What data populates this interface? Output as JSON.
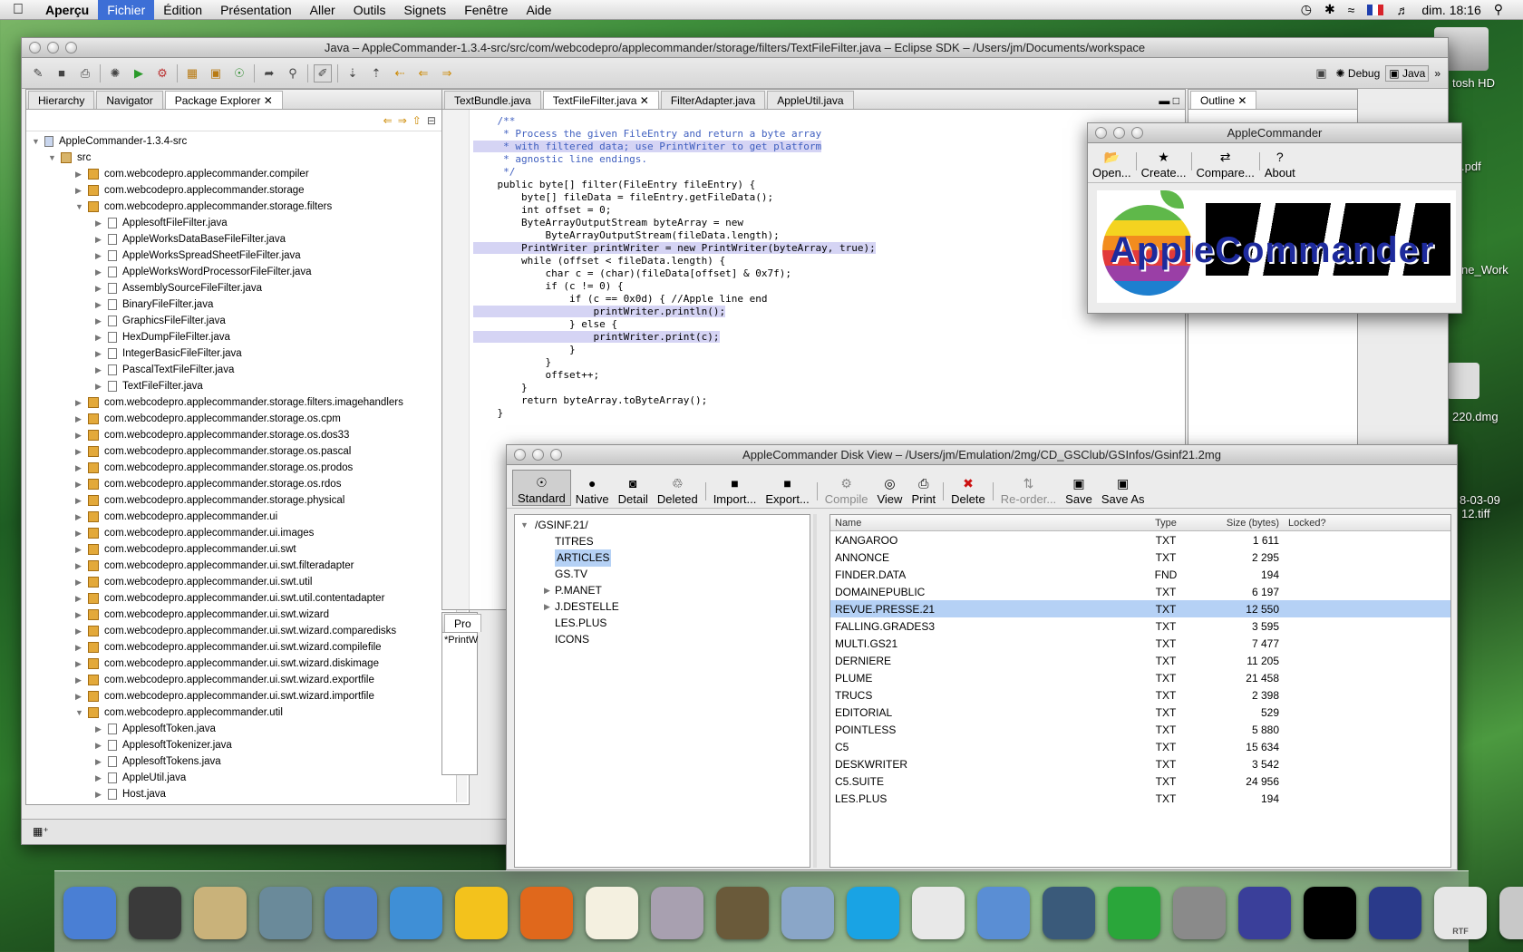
{
  "menubar": {
    "app": "Aperçu",
    "items": [
      "Fichier",
      "Édition",
      "Présentation",
      "Aller",
      "Outils",
      "Signets",
      "Fenêtre",
      "Aide"
    ],
    "clock": "dim. 18:16"
  },
  "desktop": {
    "items": [
      "tosh HD",
      ".pdf",
      "ne_Work",
      "220.dmg",
      "8-03-09",
      "12.tiff"
    ]
  },
  "eclipse": {
    "title": "Java – AppleCommander-1.3.4-src/src/com/webcodepro/applecommander/storage/filters/TextFileFilter.java – Eclipse SDK – /Users/jm/Documents/workspace",
    "perspectives": {
      "debug": "Debug",
      "java": "Java"
    },
    "left_tabs": [
      "Hierarchy",
      "Navigator",
      "Package Explorer"
    ],
    "project": "AppleCommander-1.3.4-src",
    "src": "src",
    "tree": [
      {
        "label": "com.webcodepro.applecommander.compiler",
        "t": "pkg",
        "lvl": 2,
        "ex": false
      },
      {
        "label": "com.webcodepro.applecommander.storage",
        "t": "pkg",
        "lvl": 2,
        "ex": false
      },
      {
        "label": "com.webcodepro.applecommander.storage.filters",
        "t": "pkg",
        "lvl": 2,
        "ex": true
      },
      {
        "label": "ApplesoftFileFilter.java",
        "t": "j",
        "lvl": 3
      },
      {
        "label": "AppleWorksDataBaseFileFilter.java",
        "t": "j",
        "lvl": 3
      },
      {
        "label": "AppleWorksSpreadSheetFileFilter.java",
        "t": "j",
        "lvl": 3
      },
      {
        "label": "AppleWorksWordProcessorFileFilter.java",
        "t": "j",
        "lvl": 3
      },
      {
        "label": "AssemblySourceFileFilter.java",
        "t": "j",
        "lvl": 3
      },
      {
        "label": "BinaryFileFilter.java",
        "t": "j",
        "lvl": 3
      },
      {
        "label": "GraphicsFileFilter.java",
        "t": "j",
        "lvl": 3
      },
      {
        "label": "HexDumpFileFilter.java",
        "t": "j",
        "lvl": 3
      },
      {
        "label": "IntegerBasicFileFilter.java",
        "t": "j",
        "lvl": 3
      },
      {
        "label": "PascalTextFileFilter.java",
        "t": "j",
        "lvl": 3
      },
      {
        "label": "TextFileFilter.java",
        "t": "j",
        "lvl": 3
      },
      {
        "label": "com.webcodepro.applecommander.storage.filters.imagehandlers",
        "t": "pkg",
        "lvl": 2,
        "ex": false
      },
      {
        "label": "com.webcodepro.applecommander.storage.os.cpm",
        "t": "pkg",
        "lvl": 2,
        "ex": false
      },
      {
        "label": "com.webcodepro.applecommander.storage.os.dos33",
        "t": "pkg",
        "lvl": 2,
        "ex": false
      },
      {
        "label": "com.webcodepro.applecommander.storage.os.pascal",
        "t": "pkg",
        "lvl": 2,
        "ex": false
      },
      {
        "label": "com.webcodepro.applecommander.storage.os.prodos",
        "t": "pkg",
        "lvl": 2,
        "ex": false
      },
      {
        "label": "com.webcodepro.applecommander.storage.os.rdos",
        "t": "pkg",
        "lvl": 2,
        "ex": false
      },
      {
        "label": "com.webcodepro.applecommander.storage.physical",
        "t": "pkg",
        "lvl": 2,
        "ex": false
      },
      {
        "label": "com.webcodepro.applecommander.ui",
        "t": "pkg",
        "lvl": 2,
        "ex": false
      },
      {
        "label": "com.webcodepro.applecommander.ui.images",
        "t": "pkg",
        "lvl": 2,
        "ex": false
      },
      {
        "label": "com.webcodepro.applecommander.ui.swt",
        "t": "pkg",
        "lvl": 2,
        "ex": false
      },
      {
        "label": "com.webcodepro.applecommander.ui.swt.filteradapter",
        "t": "pkg",
        "lvl": 2,
        "ex": false
      },
      {
        "label": "com.webcodepro.applecommander.ui.swt.util",
        "t": "pkg",
        "lvl": 2,
        "ex": false
      },
      {
        "label": "com.webcodepro.applecommander.ui.swt.util.contentadapter",
        "t": "pkg",
        "lvl": 2,
        "ex": false
      },
      {
        "label": "com.webcodepro.applecommander.ui.swt.wizard",
        "t": "pkg",
        "lvl": 2,
        "ex": false
      },
      {
        "label": "com.webcodepro.applecommander.ui.swt.wizard.comparedisks",
        "t": "pkg",
        "lvl": 2,
        "ex": false
      },
      {
        "label": "com.webcodepro.applecommander.ui.swt.wizard.compilefile",
        "t": "pkg",
        "lvl": 2,
        "ex": false
      },
      {
        "label": "com.webcodepro.applecommander.ui.swt.wizard.diskimage",
        "t": "pkg",
        "lvl": 2,
        "ex": false
      },
      {
        "label": "com.webcodepro.applecommander.ui.swt.wizard.exportfile",
        "t": "pkg",
        "lvl": 2,
        "ex": false
      },
      {
        "label": "com.webcodepro.applecommander.ui.swt.wizard.importfile",
        "t": "pkg",
        "lvl": 2,
        "ex": false
      },
      {
        "label": "com.webcodepro.applecommander.util",
        "t": "pkg",
        "lvl": 2,
        "ex": true
      },
      {
        "label": "ApplesoftToken.java",
        "t": "j",
        "lvl": 3
      },
      {
        "label": "ApplesoftTokenizer.java",
        "t": "j",
        "lvl": 3
      },
      {
        "label": "ApplesoftTokens.java",
        "t": "j",
        "lvl": 3
      },
      {
        "label": "AppleUtil.java",
        "t": "j",
        "lvl": 3
      },
      {
        "label": "Host.java",
        "t": "j",
        "lvl": 3
      }
    ],
    "editor_tabs": [
      "TextBundle.java",
      "TextFileFilter.java",
      "FilterAdapter.java",
      "AppleUtil.java"
    ],
    "outline_tab": "Outline",
    "bottom_tab": "Pro",
    "bottom_line": "*PrintW",
    "code": [
      {
        "text": "    /**",
        "cls": "cm",
        "hl": false
      },
      {
        "text": "     * Process the given FileEntry and return a byte array",
        "cls": "cm",
        "hl": false
      },
      {
        "text": "     * with filtered data; use PrintWriter to get platform",
        "cls": "cm",
        "hl": true
      },
      {
        "text": "     * agnostic line endings.",
        "cls": "cm",
        "hl": false
      },
      {
        "text": "     */",
        "cls": "cm",
        "hl": false
      },
      {
        "text": "    public byte[] filter(FileEntry fileEntry) {",
        "cls": "",
        "hl": false
      },
      {
        "text": "        byte[] fileData = fileEntry.getFileData();",
        "cls": "",
        "hl": false
      },
      {
        "text": "        int offset = 0;",
        "cls": "",
        "hl": false
      },
      {
        "text": "        ByteArrayOutputStream byteArray = new",
        "cls": "",
        "hl": false
      },
      {
        "text": "            ByteArrayOutputStream(fileData.length);",
        "cls": "",
        "hl": false
      },
      {
        "text": "        PrintWriter printWriter = new PrintWriter(byteArray, true);",
        "cls": "",
        "hl": true
      },
      {
        "text": "        while (offset < fileData.length) {",
        "cls": "",
        "hl": false
      },
      {
        "text": "            char c = (char)(fileData[offset] & 0x7f);",
        "cls": "",
        "hl": false
      },
      {
        "text": "            if (c != 0) {",
        "cls": "",
        "hl": false
      },
      {
        "text": "                if (c == 0x0d) { //Apple line end",
        "cls": "",
        "hl": false
      },
      {
        "text": "                    printWriter.println();",
        "cls": "",
        "hl": true
      },
      {
        "text": "                } else {",
        "cls": "",
        "hl": false
      },
      {
        "text": "                    printWriter.print(c);",
        "cls": "",
        "hl": true
      },
      {
        "text": "                }",
        "cls": "",
        "hl": false
      },
      {
        "text": "            }",
        "cls": "",
        "hl": false
      },
      {
        "text": "            offset++;",
        "cls": "",
        "hl": false
      },
      {
        "text": "        }",
        "cls": "",
        "hl": false
      },
      {
        "text": "        return byteArray.toByteArray();",
        "cls": "",
        "hl": false
      },
      {
        "text": "    }",
        "cls": "",
        "hl": false
      }
    ]
  },
  "ac_main": {
    "title": "AppleCommander",
    "buttons": [
      "Open...",
      "Create...",
      "Compare...",
      "About"
    ],
    "logo": "AppleCommander"
  },
  "diskview": {
    "title": "AppleCommander Disk View – /Users/jm/Emulation/2mg/CD_GSClub/GSInfos/Gsinf21.2mg",
    "toolbar": [
      {
        "label": "Standard",
        "state": "active"
      },
      {
        "label": "Native",
        "state": ""
      },
      {
        "label": "Detail",
        "state": ""
      },
      {
        "label": "Deleted",
        "state": "sep"
      },
      {
        "label": "Import...",
        "state": ""
      },
      {
        "label": "Export...",
        "state": "sep"
      },
      {
        "label": "Compile",
        "state": "dis"
      },
      {
        "label": "View",
        "state": ""
      },
      {
        "label": "Print",
        "state": "sep"
      },
      {
        "label": "Delete",
        "state": "sep"
      },
      {
        "label": "Re-order...",
        "state": "dis"
      },
      {
        "label": "Save",
        "state": ""
      },
      {
        "label": "Save As",
        "state": ""
      }
    ],
    "tree_root": "/GSINF.21/",
    "tree": [
      {
        "label": "TITRES",
        "ex": false,
        "sel": false
      },
      {
        "label": "ARTICLES",
        "ex": false,
        "sel": true
      },
      {
        "label": "GS.TV",
        "ex": false,
        "sel": false
      },
      {
        "label": "P.MANET",
        "ex": true,
        "sel": false
      },
      {
        "label": "J.DESTELLE",
        "ex": true,
        "sel": false
      },
      {
        "label": "LES.PLUS",
        "ex": false,
        "sel": false
      },
      {
        "label": "ICONS",
        "ex": false,
        "sel": false
      }
    ],
    "columns": [
      "Name",
      "Type",
      "Size (bytes)",
      "Locked?"
    ],
    "rows": [
      [
        "KANGAROO",
        "TXT",
        "1 611"
      ],
      [
        "ANNONCE",
        "TXT",
        "2 295"
      ],
      [
        "FINDER.DATA",
        "FND",
        "194"
      ],
      [
        "DOMAINEPUBLIC",
        "TXT",
        "6 197"
      ],
      [
        "REVUE.PRESSE.21",
        "TXT",
        "12 550"
      ],
      [
        "FALLING.GRADES3",
        "TXT",
        "3 595"
      ],
      [
        "MULTI.GS21",
        "TXT",
        "7 477"
      ],
      [
        "DERNIERE",
        "TXT",
        "11 205"
      ],
      [
        "PLUME",
        "TXT",
        "21 458"
      ],
      [
        "TRUCS",
        "TXT",
        "2 398"
      ],
      [
        "EDITORIAL",
        "TXT",
        "529"
      ],
      [
        "POINTLESS",
        "TXT",
        "5 880"
      ],
      [
        "C5",
        "TXT",
        "15 634"
      ],
      [
        "DESKWRITER",
        "TXT",
        "3 542"
      ],
      [
        "C5.SUITE",
        "TXT",
        "24 956"
      ],
      [
        "LES.PLUS",
        "TXT",
        "194"
      ]
    ],
    "selected_row": 4
  },
  "dock": {
    "icons": [
      "finder-icon",
      "dashboard-icon",
      "apple-ii-icon",
      "system-icon",
      "mail-icon",
      "safari-icon",
      "cyberduck-icon",
      "firefox-icon",
      "textedit-icon",
      "sendmail-icon",
      "gimp-icon",
      "iphoto-icon",
      "skype-icon",
      "printer-icon",
      "scanner-icon",
      "timemachine-icon",
      "upload-icon",
      "preferences-icon",
      "eclipse-icon",
      "terminal-icon",
      "star-icon",
      "rtf-document-icon",
      "trash-icon"
    ],
    "rtf_label": "RTF"
  }
}
